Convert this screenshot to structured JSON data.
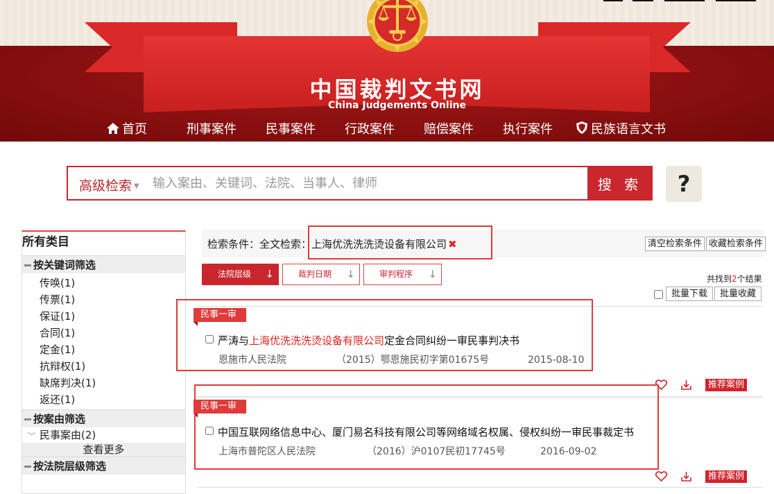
{
  "header": {
    "title": "中国裁判文书网",
    "subtitle": "China Judgements Online"
  },
  "nav": {
    "items": [
      "首页",
      "刑事案件",
      "民事案件",
      "行政案件",
      "赔偿案件",
      "执行案件",
      "民族语言文书"
    ]
  },
  "search": {
    "advanced_label": "高级检索",
    "placeholder": "输入案由、关键词、法院、当事人、律师",
    "button_label": "搜 索",
    "help_label": "?"
  },
  "sidebar": {
    "title": "所有类目",
    "keyword_group": {
      "title": "按关键词筛选",
      "items": [
        "传唤(1)",
        "传票(1)",
        "保证(1)",
        "合同(1)",
        "定金(1)",
        "抗辩权(1)",
        "缺席判决(1)",
        "返还(1)"
      ]
    },
    "cause_group": {
      "title": "按案由筛选",
      "items": [
        "民事案由(2)"
      ],
      "see_more": "查看更多"
    },
    "court_level_group": {
      "title": "按法院层级筛选"
    }
  },
  "criteria": {
    "label": "检索条件：全文检索：",
    "value": "上海优洗洗洗烫设备有限公司",
    "remove": "✖",
    "clear_label": "清空检索条件",
    "save_label": "收藏检索条件"
  },
  "sort": {
    "options": [
      "法院层级",
      "裁判日期",
      "审判程序"
    ],
    "active": "法院层级"
  },
  "results": {
    "count_prefix": "共找到",
    "count": "2",
    "count_suffix": "个结果",
    "batch_download": "批量下载",
    "batch_collect": "批量收藏",
    "items": [
      {
        "tag": "民事一审",
        "title_pre": "严涛与",
        "title_highlight": "上海优洗洗洗烫设备有限公司",
        "title_post": "定金合同纠纷一审民事判决书",
        "court": "恩施市人民法院",
        "case_no": "（2015）鄂恩施民初字第01675号",
        "date": "2015-08-10",
        "recommend": "推荐案例"
      },
      {
        "tag": "民事一审",
        "title_pre": "中国互联网络信息中心、厦门易名科技有限公司等网络域名权属、侵权纠纷一审民事裁定书",
        "title_highlight": "",
        "title_post": "",
        "court": "上海市普陀区人民法院",
        "case_no": "（2016）沪0107民初17745号",
        "date": "2016-09-02",
        "recommend": "推荐案例"
      }
    ]
  },
  "colors": {
    "brand_red": "#c9272d",
    "header_dark": "#8a1010",
    "highlight_red": "#e03a3a"
  }
}
